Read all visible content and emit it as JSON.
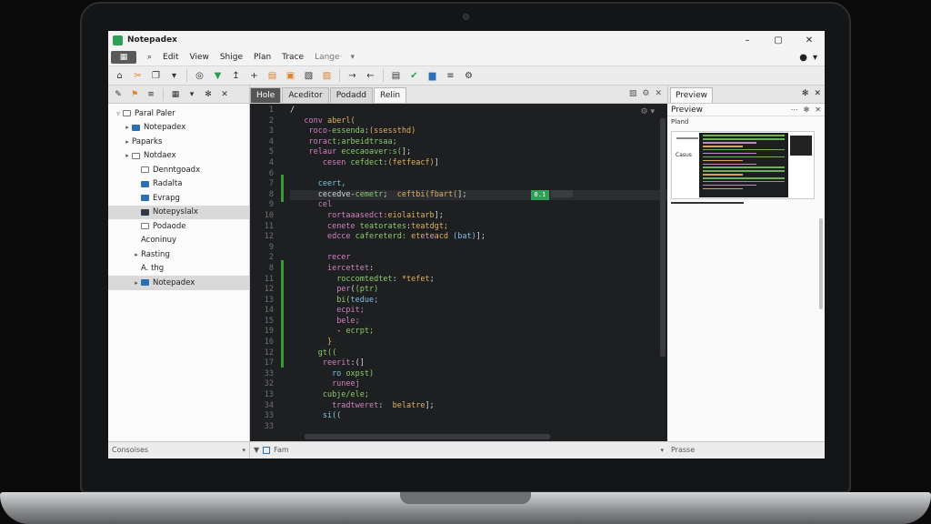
{
  "app": {
    "title": "Notepadex"
  },
  "window_controls": [
    "–",
    "▢",
    "✕"
  ],
  "menu": {
    "app_button": "▦",
    "items": [
      "Edit",
      "View",
      "Shige",
      "Plan",
      "Trace",
      "Lange"
    ]
  },
  "editor_tabs": [
    {
      "label": "Hole",
      "state": "active"
    },
    {
      "label": "Aceditor",
      "state": "normal"
    },
    {
      "label": "Podadd",
      "state": "normal"
    },
    {
      "label": "Relin",
      "state": "light"
    }
  ],
  "preview": {
    "tab": "Preview",
    "title": "Preview",
    "sub_label": "Pland",
    "thumb_label": "Casus"
  },
  "sidebar": {
    "items": [
      {
        "caret": "▿",
        "folder": "outline",
        "label": "Paral Paler",
        "indent": 0,
        "selected": false
      },
      {
        "caret": "▸",
        "folder": "blue",
        "label": "Notepadex",
        "indent": 1,
        "selected": false
      },
      {
        "caret": "▸",
        "folder": "none",
        "label": "Paparks",
        "indent": 1,
        "selected": false
      },
      {
        "caret": "▸",
        "folder": "outline",
        "label": "Notdaex",
        "indent": 1,
        "selected": false
      },
      {
        "caret": "",
        "folder": "outline",
        "label": "Denntgoadx",
        "indent": 2,
        "selected": false
      },
      {
        "caret": "",
        "folder": "blue",
        "label": "Radalta",
        "indent": 2,
        "selected": false
      },
      {
        "caret": "",
        "folder": "blue",
        "label": "Evrapg",
        "indent": 2,
        "selected": false
      },
      {
        "caret": "",
        "folder": "dark",
        "label": "Notepyslalx",
        "indent": 2,
        "selected": true
      },
      {
        "caret": "",
        "folder": "outline",
        "label": "Podaode",
        "indent": 2,
        "selected": false
      },
      {
        "caret": "",
        "folder": "none",
        "label": "Aconinuy",
        "indent": 2,
        "selected": false
      },
      {
        "caret": "▸",
        "folder": "none",
        "label": "Rasting",
        "indent": 2,
        "selected": false
      },
      {
        "caret": "",
        "folder": "none",
        "label": "A. thg",
        "indent": 2,
        "selected": false
      },
      {
        "caret": "▸",
        "folder": "blue",
        "label": "Notepadex",
        "indent": 2,
        "selected": true
      }
    ]
  },
  "editor": {
    "line_numbers": [
      "1",
      "2",
      "3",
      "4",
      "5",
      "4",
      "6",
      "7",
      "8",
      "9",
      "10",
      "11",
      "12",
      "9",
      "2",
      "8",
      "11",
      "12",
      "13",
      "14",
      "15",
      "19",
      "16",
      "12",
      "17",
      "33",
      "32",
      "13",
      "34",
      "33",
      "33"
    ],
    "lines": [
      [
        {
          "c": "w",
          "t": "/"
        }
      ],
      [
        {
          "c": "w",
          "t": "   "
        },
        {
          "c": "k",
          "t": "conv"
        },
        {
          "c": "w",
          "t": " "
        },
        {
          "c": "f",
          "t": "aberl("
        }
      ],
      [
        {
          "c": "w",
          "t": "    "
        },
        {
          "c": "k",
          "t": "roco-"
        },
        {
          "c": "g",
          "t": "essenda"
        },
        {
          "c": "w",
          "t": ":"
        },
        {
          "c": "f",
          "t": "(ssessthd)"
        }
      ],
      [
        {
          "c": "w",
          "t": "    "
        },
        {
          "c": "k",
          "t": "rorac"
        },
        {
          "c": "g",
          "t": "t;arbeidtrsaa;"
        }
      ],
      [
        {
          "c": "w",
          "t": "    "
        },
        {
          "c": "k",
          "t": "relaur"
        },
        {
          "c": "w",
          "t": " "
        },
        {
          "c": "g",
          "t": "ececaoaver:s("
        },
        {
          "c": "w",
          "t": "];"
        }
      ],
      [
        {
          "c": "w",
          "t": "       "
        },
        {
          "c": "k",
          "t": "cesen"
        },
        {
          "c": "w",
          "t": " "
        },
        {
          "c": "g",
          "t": "cefdect"
        },
        {
          "c": "w",
          "t": ":"
        },
        {
          "c": "f",
          "t": "(fetfeacf)"
        },
        {
          "c": "w",
          "t": "]"
        }
      ],
      [
        {
          "c": "w",
          "t": ""
        }
      ],
      [
        {
          "c": "w",
          "t": "      "
        },
        {
          "c": "s",
          "t": "ceert,"
        }
      ],
      [
        {
          "c": "w",
          "t": "      "
        },
        {
          "c": "w",
          "t": "cecedve-"
        },
        {
          "c": "g",
          "t": "cemetr"
        },
        {
          "c": "w",
          "t": ";  "
        },
        {
          "c": "f",
          "t": "ceftbi(fbart("
        },
        {
          "c": "w",
          "t": "];"
        }
      ],
      [
        {
          "c": "w",
          "t": "      "
        },
        {
          "c": "k",
          "t": "cel"
        }
      ],
      [
        {
          "c": "w",
          "t": "        "
        },
        {
          "c": "k",
          "t": "rortaaasedct"
        },
        {
          "c": "f",
          "t": ":eiolaitarb"
        },
        {
          "c": "w",
          "t": "];"
        }
      ],
      [
        {
          "c": "w",
          "t": "        "
        },
        {
          "c": "k",
          "t": "cenete"
        },
        {
          "c": "w",
          "t": " "
        },
        {
          "c": "g",
          "t": "teatorates"
        },
        {
          "c": "w",
          "t": ":"
        },
        {
          "c": "f",
          "t": "teatdgt;"
        }
      ],
      [
        {
          "c": "w",
          "t": "        "
        },
        {
          "c": "k",
          "t": "edcce"
        },
        {
          "c": "w",
          "t": " "
        },
        {
          "c": "g",
          "t": "cafereterd:"
        },
        {
          "c": "w",
          "t": " "
        },
        {
          "c": "f",
          "t": "eteteacd"
        },
        {
          "c": "w",
          "t": " "
        },
        {
          "c": "s",
          "t": "(bat)"
        },
        {
          "c": "w",
          "t": "];"
        }
      ],
      [
        {
          "c": "w",
          "t": ""
        }
      ],
      [
        {
          "c": "w",
          "t": "        "
        },
        {
          "c": "k",
          "t": "recer"
        }
      ],
      [
        {
          "c": "w",
          "t": "        "
        },
        {
          "c": "k",
          "t": "iercettet"
        },
        {
          "c": "w",
          "t": ":"
        }
      ],
      [
        {
          "c": "w",
          "t": "          "
        },
        {
          "c": "g",
          "t": "roccomtedtet"
        },
        {
          "c": "w",
          "t": ": "
        },
        {
          "c": "f",
          "t": "*tefet"
        },
        {
          "c": "w",
          "t": ";"
        }
      ],
      [
        {
          "c": "w",
          "t": "          "
        },
        {
          "c": "k",
          "t": "per"
        },
        {
          "c": "w",
          "t": "("
        },
        {
          "c": "g",
          "t": "(ptr)"
        }
      ],
      [
        {
          "c": "w",
          "t": "          "
        },
        {
          "c": "g",
          "t": "bi("
        },
        {
          "c": "s",
          "t": "tedue;"
        }
      ],
      [
        {
          "c": "w",
          "t": "          "
        },
        {
          "c": "k",
          "t": "ecpit;"
        }
      ],
      [
        {
          "c": "w",
          "t": "          "
        },
        {
          "c": "k",
          "t": "bele;"
        }
      ],
      [
        {
          "c": "w",
          "t": "          "
        },
        {
          "c": "w",
          "t": "- "
        },
        {
          "c": "g",
          "t": "ecrpt;"
        }
      ],
      [
        {
          "c": "w",
          "t": "        "
        },
        {
          "c": "f",
          "t": "}"
        }
      ],
      [
        {
          "c": "w",
          "t": "      "
        },
        {
          "c": "g",
          "t": "gt(("
        }
      ],
      [
        {
          "c": "w",
          "t": "       "
        },
        {
          "c": "k",
          "t": "reerit"
        },
        {
          "c": "w",
          "t": ":(]"
        }
      ],
      [
        {
          "c": "w",
          "t": "         "
        },
        {
          "c": "s",
          "t": "ro"
        },
        {
          "c": "w",
          "t": " "
        },
        {
          "c": "g",
          "t": "oxpst)"
        }
      ],
      [
        {
          "c": "w",
          "t": "         "
        },
        {
          "c": "k",
          "t": "runeej"
        }
      ],
      [
        {
          "c": "w",
          "t": "       "
        },
        {
          "c": "g",
          "t": "cubje/ele;"
        }
      ],
      [
        {
          "c": "w",
          "t": "         "
        },
        {
          "c": "k",
          "t": "tradtweret"
        },
        {
          "c": "w",
          "t": ":  "
        },
        {
          "c": "f",
          "t": "belatre"
        },
        {
          "c": "w",
          "t": "];"
        }
      ],
      [
        {
          "c": "w",
          "t": "       "
        },
        {
          "c": "s",
          "t": "si(("
        }
      ],
      [
        {
          "c": "w",
          "t": ""
        }
      ]
    ],
    "highlight_line": 8,
    "line_badge": "0.1"
  },
  "status": {
    "left": "Consoises",
    "mid": "Fam",
    "right": "Prasse"
  }
}
